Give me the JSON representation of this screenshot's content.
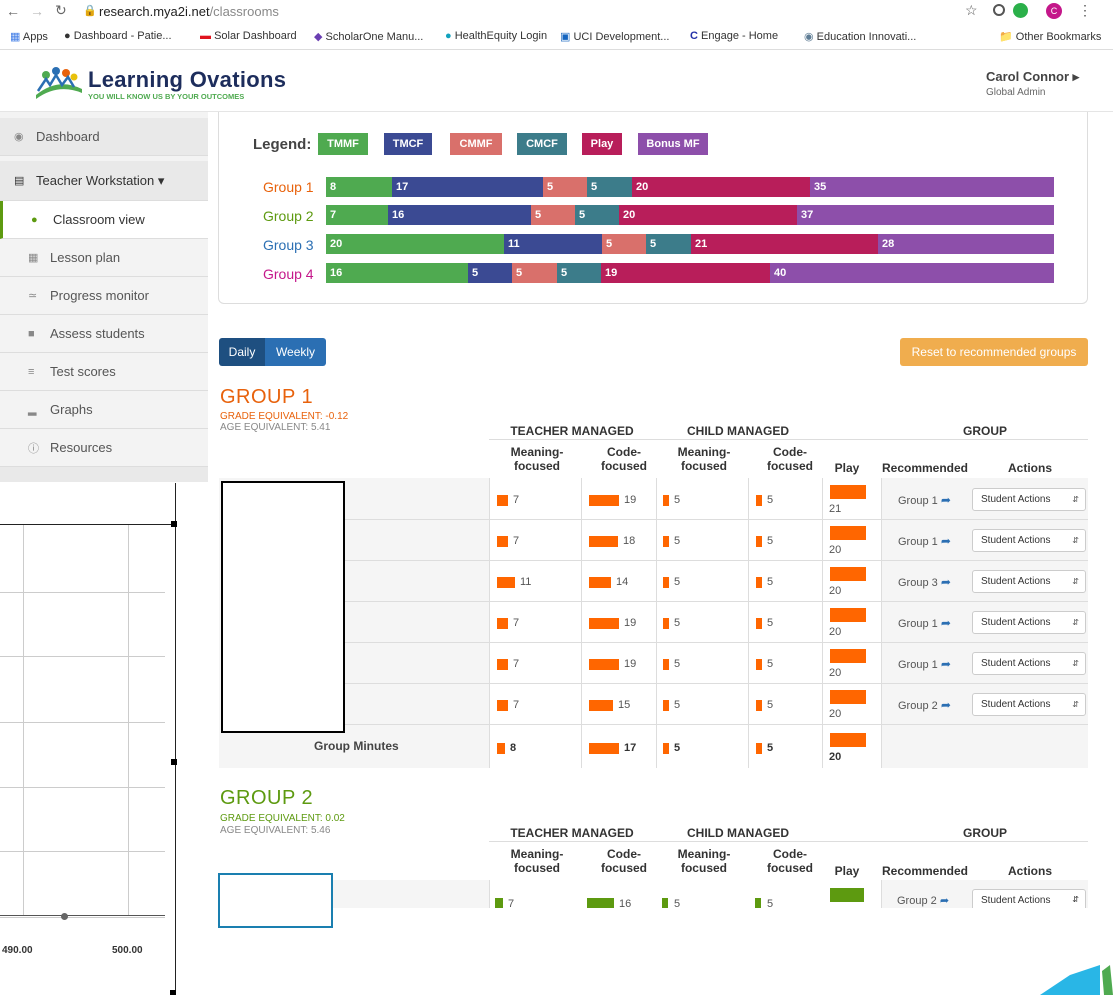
{
  "browser": {
    "url_host": "research.mya2i.net",
    "url_path": "/classrooms"
  },
  "bookmarks": [
    "Apps",
    "Dashboard - Patie...",
    "Solar Dashboard",
    "ScholarOne Manu...",
    "HealthEquity Login",
    "UCI Development...",
    "Engage - Home",
    "Education Innovati...",
    "Other Bookmarks"
  ],
  "brand": {
    "name": "Learning Ovations",
    "tagline": "YOU WILL KNOW US BY YOUR OUTCOMES"
  },
  "user": {
    "name": "Carol Connor ▸",
    "role": "Global Admin"
  },
  "sidebar": {
    "items": [
      {
        "label": "Dashboard",
        "icon": "dashboard-icon"
      },
      {
        "label": "Teacher Workstation ▾",
        "icon": "teacher-icon"
      },
      {
        "label": "Classroom view",
        "icon": "apple-icon"
      },
      {
        "label": "Lesson plan",
        "icon": "grid-icon"
      },
      {
        "label": "Progress monitor",
        "icon": "chart-line-icon"
      },
      {
        "label": "Assess students",
        "icon": "assess-icon"
      },
      {
        "label": "Test scores",
        "icon": "list-icon"
      },
      {
        "label": "Graphs",
        "icon": "bar-chart-icon"
      },
      {
        "label": "Resources",
        "icon": "info-icon"
      }
    ]
  },
  "legend": {
    "label": "Legend:",
    "items": [
      {
        "label": "TMMF",
        "color": "#4faa50"
      },
      {
        "label": "TMCF",
        "color": "#3b4a93"
      },
      {
        "label": "CMMF",
        "color": "#d9706b"
      },
      {
        "label": "CMCF",
        "color": "#3c7c8a"
      },
      {
        "label": "Play",
        "color": "#b81e5a"
      },
      {
        "label": "Bonus MF",
        "color": "#8d4faa"
      }
    ]
  },
  "group_bars": [
    {
      "name": "Group 1",
      "color": "#e8620c",
      "values": [
        "8",
        "17",
        "5",
        "5",
        "20",
        "35"
      ]
    },
    {
      "name": "Group 2",
      "color": "#5d9a10",
      "values": [
        "7",
        "16",
        "5",
        "5",
        "20",
        "37"
      ]
    },
    {
      "name": "Group 3",
      "color": "#2b6fb3",
      "values": [
        "20",
        "11",
        "5",
        "5",
        "21",
        "28"
      ]
    },
    {
      "name": "Group 4",
      "color": "#c4178a",
      "values": [
        "16",
        "5",
        "5",
        "5",
        "19",
        "40"
      ]
    }
  ],
  "view_toggle": {
    "daily": "Daily",
    "weekly": "Weekly"
  },
  "reset_button": "Reset to recommended groups",
  "headers": {
    "teacher": "TEACHER MANAGED",
    "child": "CHILD MANAGED",
    "group": "GROUP",
    "mf": "Meaning-",
    "mf2": "focused",
    "cf": "Code-",
    "cf2": "focused",
    "play": "Play",
    "recommended": "Recommended",
    "actions": "Actions"
  },
  "group1": {
    "title": "GROUP 1",
    "grade": "GRADE EQUIVALENT: -0.12",
    "age": "AGE EQUIVALENT: 5.41",
    "rows": [
      {
        "tmmf": "7",
        "tmcf": "19",
        "cmmf": "5",
        "cmcf": "5",
        "play": "21",
        "rec": "Group 1"
      },
      {
        "tmmf": "7",
        "tmcf": "18",
        "cmmf": "5",
        "cmcf": "5",
        "play": "20",
        "rec": "Group 1"
      },
      {
        "tmmf": "11",
        "tmcf": "14",
        "cmmf": "5",
        "cmcf": "5",
        "play": "20",
        "rec": "Group 3"
      },
      {
        "tmmf": "7",
        "tmcf": "19",
        "cmmf": "5",
        "cmcf": "5",
        "play": "20",
        "rec": "Group 1"
      },
      {
        "tmmf": "7",
        "tmcf": "19",
        "cmmf": "5",
        "cmcf": "5",
        "play": "20",
        "rec": "Group 1"
      },
      {
        "tmmf": "7",
        "tmcf": "15",
        "cmmf": "5",
        "cmcf": "5",
        "play": "20",
        "rec": "Group 2"
      }
    ],
    "minutes_label": "Group Minutes",
    "minutes": {
      "tmmf": "8",
      "tmcf": "17",
      "cmmf": "5",
      "cmcf": "5",
      "play": "20"
    }
  },
  "group2": {
    "title": "GROUP 2",
    "grade": "GRADE EQUIVALENT: 0.02",
    "age": "AGE EQUIVALENT: 5.46",
    "rows": [
      {
        "tmmf": "7",
        "tmcf": "16",
        "cmmf": "5",
        "cmcf": "5",
        "rec": "Group 2"
      }
    ]
  },
  "student_actions": "Student Actions",
  "overlay_chart": {
    "ticks": [
      "490.00",
      "500.00"
    ]
  },
  "colors": {
    "orange": "#ff6600",
    "green": "#5d9a10",
    "accent_blue": "#2b6fb3"
  }
}
